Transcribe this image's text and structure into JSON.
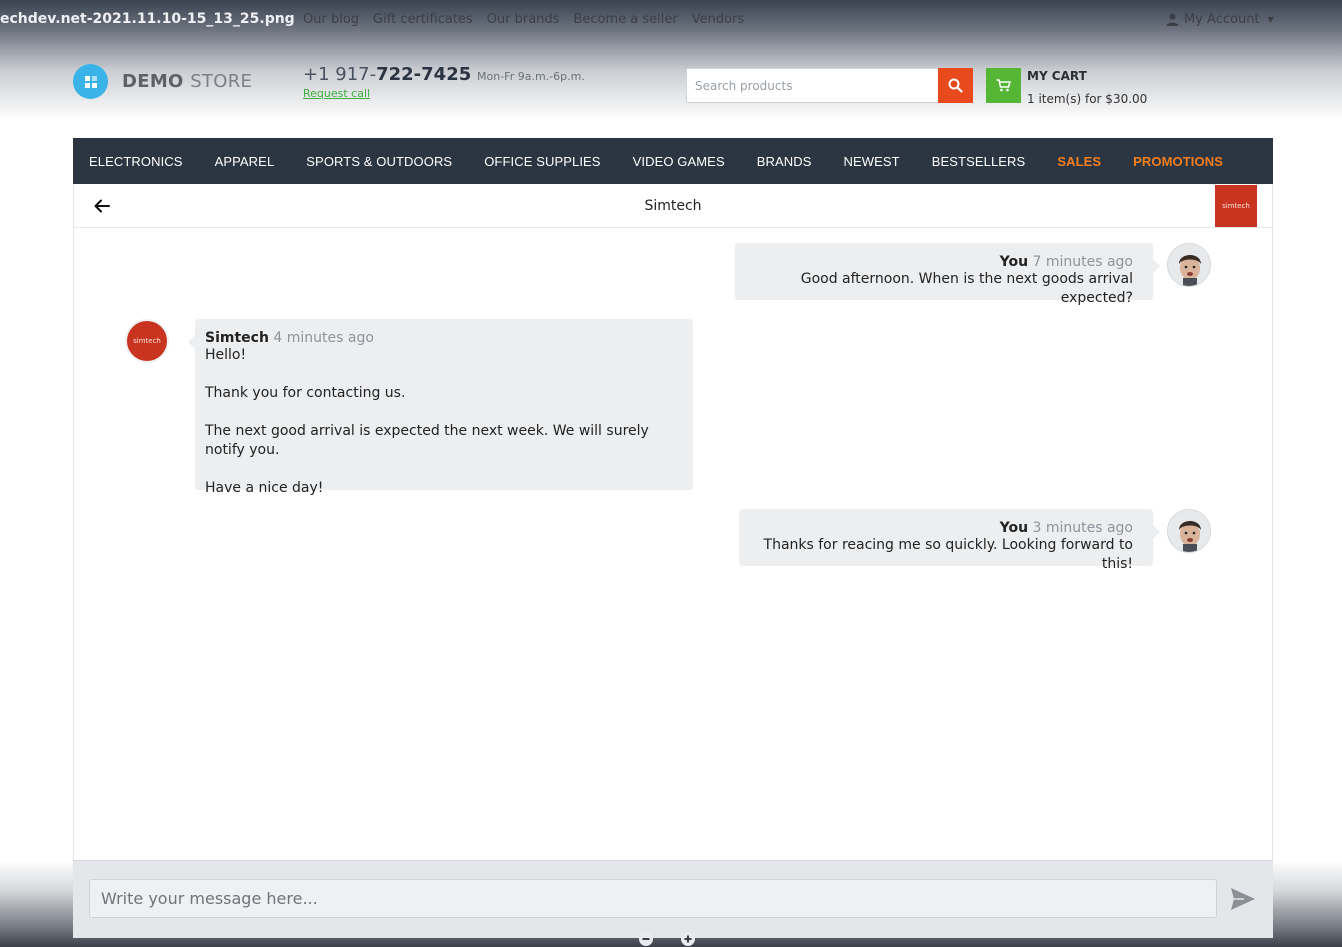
{
  "window": {
    "filename": "echdev.net-2021.11.10-15_13_25.png"
  },
  "topbar": {
    "links": [
      "Our blog",
      "Gift certificates",
      "Our brands",
      "Become a seller",
      "Vendors"
    ],
    "account_label": "My Account"
  },
  "header": {
    "logo_bold": "DEMO",
    "logo_light": "STORE",
    "phone_prefix": "+1 917-",
    "phone_main": "722-7425",
    "phone_hours": "Mon-Fr 9a.m.-6p.m.",
    "request_call": "Request call",
    "search_placeholder": "Search products",
    "cart_title": "MY CART",
    "cart_summary": "1 item(s) for $30.00"
  },
  "nav": {
    "items": [
      {
        "label": "ELECTRONICS",
        "highlight": false
      },
      {
        "label": "APPAREL",
        "highlight": false
      },
      {
        "label": "SPORTS & OUTDOORS",
        "highlight": false
      },
      {
        "label": "OFFICE SUPPLIES",
        "highlight": false
      },
      {
        "label": "VIDEO GAMES",
        "highlight": false
      },
      {
        "label": "BRANDS",
        "highlight": false
      },
      {
        "label": "NEWEST",
        "highlight": false
      },
      {
        "label": "BESTSELLERS",
        "highlight": false
      },
      {
        "label": "SALES",
        "highlight": true
      },
      {
        "label": "PROMOTIONS",
        "highlight": true
      }
    ]
  },
  "chat": {
    "title": "Simtech",
    "vendor_logo_text": "simtech",
    "messages": [
      {
        "author": "You",
        "time": "7 minutes ago",
        "lines": [
          "Good afternoon. When is the next goods arrival expected?"
        ]
      },
      {
        "author": "Simtech",
        "time": "4 minutes ago",
        "lines": [
          "Hello!",
          "Thank you for contacting us.",
          "The next good arrival is expected the next week. We will surely notify you.",
          "Have a nice day!"
        ]
      },
      {
        "author": "You",
        "time": "3 minutes ago",
        "lines": [
          "Thanks for reacing me so quickly. Looking forward to this!"
        ]
      }
    ],
    "composer_placeholder": "Write your message here..."
  },
  "colors": {
    "nav_bg": "#2c3642",
    "accent_orange": "#f27e1e",
    "search_button": "#e8491d",
    "cart_button": "#55b534",
    "link_green": "#3cae3c",
    "logo_blue": "#3ab4e8",
    "vendor_red": "#c8341f"
  },
  "icons": [
    "back-arrow-icon",
    "search-icon",
    "cart-icon",
    "user-icon",
    "send-icon",
    "zoom-out-icon",
    "zoom-in-icon"
  ]
}
